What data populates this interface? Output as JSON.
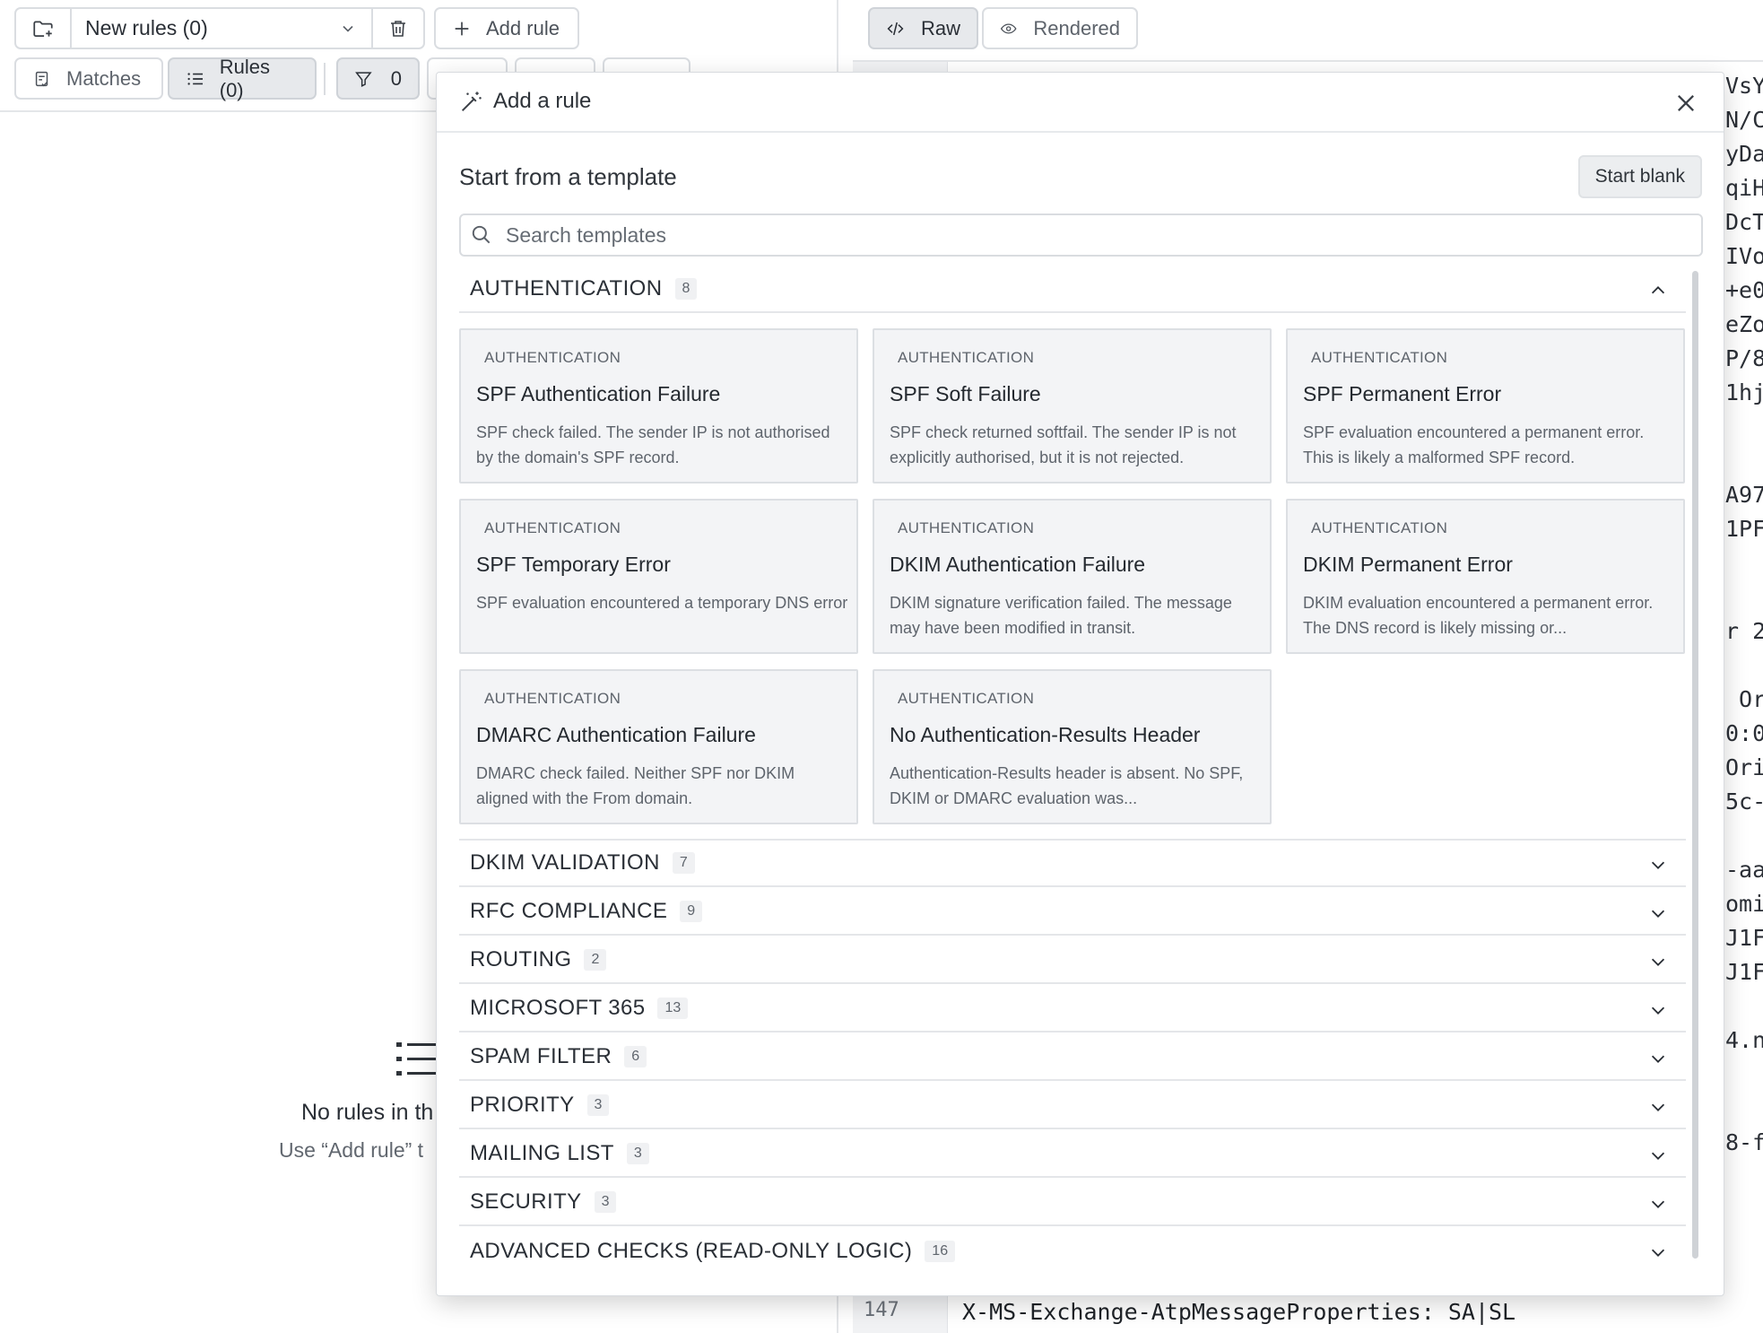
{
  "toolbar": {
    "ruleset_label": "New rules (0)",
    "add_rule_label": "Add rule",
    "matches_label": "Matches",
    "rules_label": "Rules (0)",
    "filter_count": "0"
  },
  "empty_state": {
    "title": "No rules in th",
    "hint": "Use “Add rule” t"
  },
  "view_toggle": {
    "raw_label": "Raw",
    "rendered_label": "Rendered"
  },
  "raw_view": {
    "line_number": "147",
    "line_text": "X-MS-Exchange-AtpMessageProperties: SA|SL",
    "edge_fragments": [
      "VsY",
      "N/C",
      "yDa",
      "qiH",
      "DcT",
      "IVo",
      "+e0",
      "eZo",
      "P/8",
      "1hj",
      "A97",
      "1PF",
      "r 2",
      " Or",
      "0:0",
      "Ori",
      "5c-",
      "-aa",
      "omi",
      "J1F",
      "J1F",
      "4.n",
      "8-f"
    ]
  },
  "modal": {
    "title": "Add a rule",
    "section_title": "Start from a template",
    "start_blank_label": "Start blank",
    "search_placeholder": "Search templates",
    "expanded_category": {
      "name": "AUTHENTICATION",
      "count": "8"
    },
    "cards": [
      {
        "tag": "AUTHENTICATION",
        "title": "SPF Authentication Failure",
        "desc": "SPF check failed. The sender IP is not authorised by the domain's SPF record."
      },
      {
        "tag": "AUTHENTICATION",
        "title": "SPF Soft Failure",
        "desc": "SPF check returned softfail. The sender IP is not explicitly authorised, but it is not rejected."
      },
      {
        "tag": "AUTHENTICATION",
        "title": "SPF Permanent Error",
        "desc": "SPF evaluation encountered a permanent error. This is likely a malformed SPF record."
      },
      {
        "tag": "AUTHENTICATION",
        "title": "SPF Temporary Error",
        "desc": "SPF evaluation encountered a temporary DNS error"
      },
      {
        "tag": "AUTHENTICATION",
        "title": "DKIM Authentication Failure",
        "desc": "DKIM signature verification failed. The message may have been modified in transit."
      },
      {
        "tag": "AUTHENTICATION",
        "title": "DKIM Permanent Error",
        "desc": "DKIM evaluation encountered a permanent error. The DNS record is likely missing or..."
      },
      {
        "tag": "AUTHENTICATION",
        "title": "DMARC Authentication Failure",
        "desc": "DMARC check failed. Neither SPF nor DKIM aligned with the From domain."
      },
      {
        "tag": "AUTHENTICATION",
        "title": "No Authentication-Results Header",
        "desc": "Authentication-Results header is absent. No SPF, DKIM or DMARC evaluation was..."
      }
    ],
    "categories": [
      {
        "name": "DKIM VALIDATION",
        "count": "7"
      },
      {
        "name": "RFC COMPLIANCE",
        "count": "9"
      },
      {
        "name": "ROUTING",
        "count": "2"
      },
      {
        "name": "MICROSOFT 365",
        "count": "13"
      },
      {
        "name": "SPAM FILTER",
        "count": "6"
      },
      {
        "name": "PRIORITY",
        "count": "3"
      },
      {
        "name": "MAILING LIST",
        "count": "3"
      },
      {
        "name": "SECURITY",
        "count": "3"
      },
      {
        "name": "ADVANCED CHECKS (READ-ONLY LOGIC)",
        "count": "16"
      }
    ]
  }
}
